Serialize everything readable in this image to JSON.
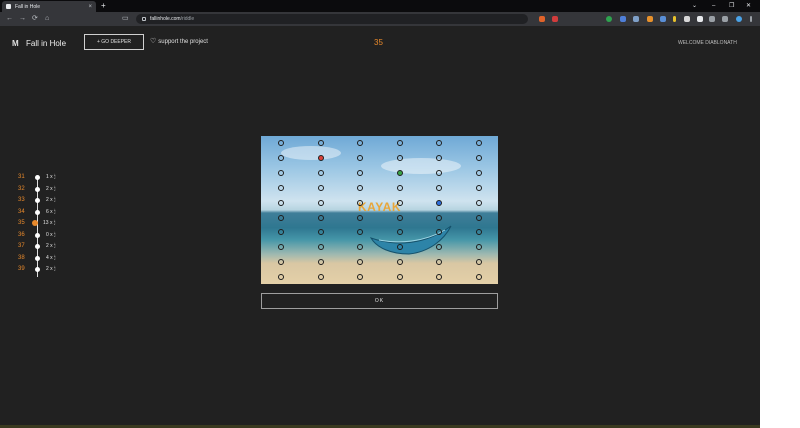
{
  "browser": {
    "tab_title": "Fall in Hole",
    "tab_close": "×",
    "new_tab": "+",
    "url_host": "fallinhole.com",
    "url_path": "/riddle",
    "nav": {
      "back": "←",
      "forward": "→",
      "reload": "⟳",
      "home": "⌂"
    },
    "window": {
      "chevron": "⌄",
      "minimize": "–",
      "restore": "❐",
      "close": "✕"
    }
  },
  "header": {
    "logo_glyph": "M",
    "title": "Fall in Hole",
    "go_deeper": "+ GO DEEPER",
    "support_heart": "♡",
    "support": "support the project",
    "level": "35",
    "welcome": "WELCOME DIABLONATH"
  },
  "ladder": [
    {
      "level": "31",
      "count": "1 x 🕯"
    },
    {
      "level": "32",
      "count": "2 x 🕯"
    },
    {
      "level": "33",
      "count": "2 x 🕯"
    },
    {
      "level": "34",
      "count": "6 x 🕯"
    },
    {
      "level": "35",
      "count": "13 x 🕯",
      "current": true
    },
    {
      "level": "36",
      "count": "0 x 🕯"
    },
    {
      "level": "37",
      "count": "2 x 🕯"
    },
    {
      "level": "38",
      "count": "4 x 🕯"
    },
    {
      "level": "39",
      "count": "2 x 🕯"
    }
  ],
  "puzzle": {
    "word": "KAYAK",
    "rows": 10,
    "cols": 6,
    "marked": [
      {
        "row": 1,
        "col": 1,
        "color": "red"
      },
      {
        "row": 2,
        "col": 3,
        "color": "green"
      },
      {
        "row": 4,
        "col": 4,
        "color": "blue"
      }
    ]
  },
  "ok_label": "OK"
}
